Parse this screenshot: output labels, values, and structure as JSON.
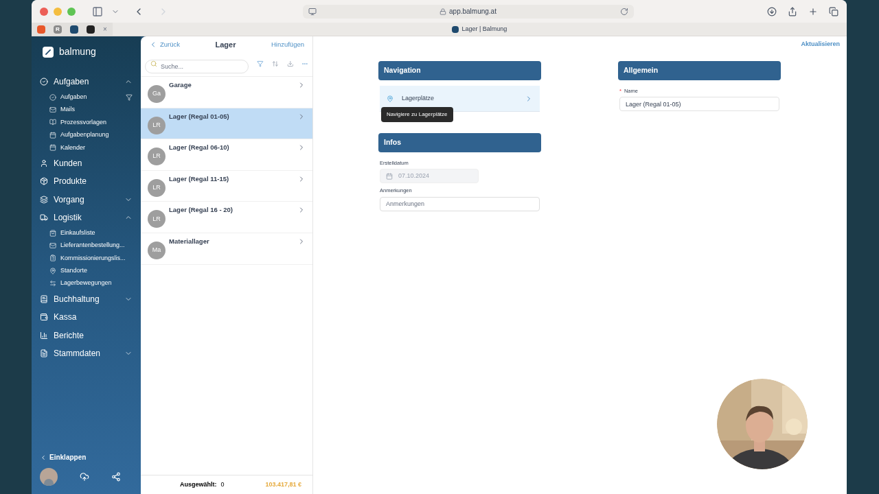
{
  "browser": {
    "url": "app.balmung.at",
    "tab_title": "Lager | Balmung"
  },
  "pinned_tabs": [
    {
      "kind": "fox"
    },
    {
      "kind": "letter",
      "text": "R"
    },
    {
      "kind": "slash"
    },
    {
      "kind": "dark"
    }
  ],
  "close_tab": "×",
  "sidebar": {
    "brand": "balmung",
    "items": [
      {
        "label": "Aufgaben",
        "kind": "group",
        "expanded": true,
        "children": [
          {
            "label": "Aufgaben",
            "filter": true
          },
          {
            "label": "Mails"
          },
          {
            "label": "Prozessvorlagen"
          },
          {
            "label": "Aufgabenplanung"
          },
          {
            "label": "Kalender"
          }
        ]
      },
      {
        "label": "Kunden",
        "kind": "link"
      },
      {
        "label": "Produkte",
        "kind": "link"
      },
      {
        "label": "Vorgang",
        "kind": "group",
        "expanded": false
      },
      {
        "label": "Logistik",
        "kind": "group",
        "expanded": true,
        "children": [
          {
            "label": "Einkaufsliste"
          },
          {
            "label": "Lieferantenbestellung..."
          },
          {
            "label": "Kommissionierungslis..."
          },
          {
            "label": "Standorte"
          },
          {
            "label": "Lagerbewegungen"
          }
        ]
      },
      {
        "label": "Buchhaltung",
        "kind": "group",
        "expanded": false
      },
      {
        "label": "Kassa",
        "kind": "link"
      },
      {
        "label": "Berichte",
        "kind": "link"
      },
      {
        "label": "Stammdaten",
        "kind": "group",
        "expanded": false
      }
    ],
    "collapse": "Einklappen"
  },
  "list": {
    "back": "Zurück",
    "title": "Lager",
    "add": "Hinzufügen",
    "search": {
      "placeholder": "Suche..."
    },
    "rows": [
      {
        "initials": "Ga",
        "name": "Garage",
        "selected": false
      },
      {
        "initials": "LR",
        "name": "Lager (Regal 01-05)",
        "selected": true
      },
      {
        "initials": "LR",
        "name": "Lager (Regal 06-10)",
        "selected": false
      },
      {
        "initials": "LR",
        "name": "Lager (Regal 11-15)",
        "selected": false
      },
      {
        "initials": "LR",
        "name": "Lager (Regal 16 - 20)",
        "selected": false
      },
      {
        "initials": "Ma",
        "name": "Materiallager",
        "selected": false
      }
    ],
    "footer": {
      "label": "Ausgewählt:",
      "count": "0",
      "total": "103.417,81 €"
    }
  },
  "detail": {
    "refresh": "Aktualisieren",
    "navigation": {
      "title": "Navigation",
      "items": [
        {
          "label": "Lagerplätze"
        }
      ],
      "tooltip": "Navigiere zu Lagerplätze"
    },
    "infos": {
      "title": "Infos",
      "fields": [
        {
          "label": "Erstelldatum",
          "value": "07.10.2024",
          "disabled": true
        },
        {
          "label": "Anmerkungen",
          "placeholder": "Anmerkungen",
          "disabled": false
        }
      ]
    },
    "general": {
      "title": "Allgemein",
      "fields": [
        {
          "label": "Name",
          "required_mark": "*",
          "value": "Lager (Regal 01-05)"
        }
      ]
    }
  }
}
